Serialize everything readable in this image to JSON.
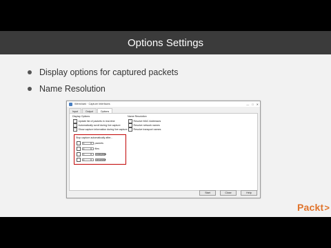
{
  "slide": {
    "title": "Options Settings",
    "bullets": [
      "Display options for captured packets",
      "Name Resolution"
    ]
  },
  "dialog": {
    "title": "Wireshark · Capture Interfaces",
    "window_controls": [
      "—",
      "□",
      "✕"
    ],
    "tabs": [
      "Input",
      "Output",
      "Options"
    ],
    "active_tab": "Options",
    "display_options": {
      "title": "Display Options",
      "items": [
        {
          "label": "Update list of packets in real-time",
          "checked": true
        },
        {
          "label": "Automatically scroll during live capture",
          "checked": true
        },
        {
          "label": "Show capture information during live capture",
          "checked": true
        }
      ]
    },
    "name_resolution": {
      "title": "Name Resolution",
      "items": [
        {
          "label": "Resolve MAC Addresses",
          "checked": true
        },
        {
          "label": "Resolve network names",
          "checked": false
        },
        {
          "label": "Resolve transport names",
          "checked": false
        }
      ]
    },
    "stop_capture": {
      "title": "Stop capture automatically after...",
      "rows": [
        {
          "value": "1",
          "unit": "packets",
          "is_select": false
        },
        {
          "value": "1",
          "unit": "files",
          "is_select": false
        },
        {
          "value": "1",
          "unit": "kilobytes",
          "is_select": true
        },
        {
          "value": "1",
          "unit": "seconds",
          "is_select": true
        }
      ]
    },
    "buttons": [
      "Start",
      "Close",
      "Help"
    ]
  },
  "brand": {
    "logo_text": "Packt",
    "logo_arrow": ">",
    "accent": "#e0732b",
    "title_bar_color": "#3b3b3b",
    "highlight_color": "#c00000"
  }
}
